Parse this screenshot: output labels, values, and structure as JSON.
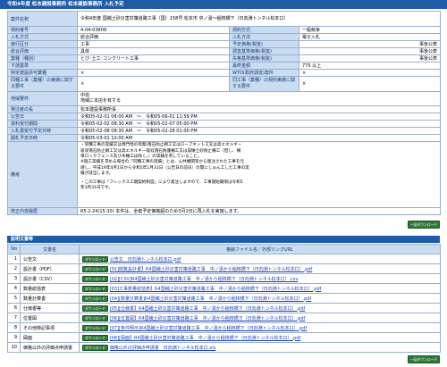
{
  "header": {
    "title": "令和4年度 松本建設事務所 松本建設事務所 入札予定"
  },
  "details": {
    "project_name_label": "案件名称",
    "project_name": "令和4年度 国補土砂災害対策道路工事（国）158号 松本市 中ノ湯～稲核橋下（日向淵トンネル松本口）",
    "contract_no_label": "契約番号",
    "contract_no": "4-04-03809",
    "contract_type_label": "契約方式",
    "contract_type": "一般競争",
    "bid_method_label": "入札方式",
    "bid_method": "総合評価",
    "bid_form_label": "入札方法",
    "bid_form": "電子入札",
    "category_label": "施行区分",
    "category": "工事",
    "price_tier_label": "予定価格(税抜)",
    "price_tier": "事後公表",
    "eval_label": "総合評価",
    "eval": "具体",
    "survey_label": "調査基準価格(税抜)",
    "survey": "事後公表",
    "type_label": "業種（種別）",
    "type": "とび･土工･コンクリート工事",
    "min_label": "失格基準価格(税抜)",
    "min": "事後公表",
    "deadline_label": "下請基準",
    "deadline": "",
    "amount_label": "最終金額",
    "amount": "775 以上",
    "spec_label": "特定建設許可業種",
    "spec": "×",
    "wto_label": "WTO(政府調達)案件",
    "wto": "×",
    "same_label": "同種工事（業種）の実績に関する要件",
    "same": "×",
    "equiv_label": "同工事（業種）の契約実績に関する要件",
    "equiv": "×",
    "region_label": "地域要件",
    "region_1": "中信",
    "region_2": "地域に本店を有する",
    "office_label": "発注者の長",
    "office": "松本建設事務所長",
    "pub_label": "公告日",
    "pub": "令和05-02-01 08:00 AM　～　令和05-06-01 11:59 PM",
    "apply_label": "資料受付期間",
    "apply": "令和05-02-02 08:30 AM　～　令和05-02-07 05:00 PM",
    "bid_label": "入札書受付予定日時",
    "bid": "令和05-02-08 08:30 AM　～　令和05-02-28 01:00 PM",
    "open_label": "開札予定日時",
    "open": "令和05-03-01 10:00 AM",
    "notes_label": "備考",
    "notes_1": "・同種工事の実績又は専門性の有無/落石防止網工又はロープネット工又は高エネルギー",
    "notes_2": "吸収落石防止網工又は高エネルギー吸収落石防護柵工又は崩壊土砂防止柵工（但し、横",
    "notes_3": "単ロックフェンス及び木柵工は除く。）の実績を有していること。",
    "notes_4": "※施工実績を求める場合の「同種工事の実績」とは、公共機関等から発注された工事を元",
    "notes_5": "請し、平成19年4月1日から令和5年1月31日（公告日の前日）の間にしゅん工した工事の実",
    "notes_6": "績が該当します。",
    "notes_7": "・この工事は「フレックス工期契約制度」により発注しますので、工事開始期限は令和5",
    "notes_8": "年3月31日です。",
    "revise_label": "修正内容履歴",
    "revise": "R5.2.24(15:30) 本件は、全者予定価格超のため3月1日に再入札を実施します。"
  },
  "download_all_top": "一括ダウンロード",
  "docs": {
    "title": "拡明文書等",
    "col_no": "No",
    "col_name": "文書名",
    "col_file": "格納ファイル名／外部リンクURL",
    "dl_label": "ダウンロード",
    "rows": [
      {
        "no": "1",
        "name": "公告文",
        "file": "公告文　日向淵トンネル松本口.pdf"
      },
      {
        "no": "2",
        "name": "設計書（PDF）",
        "file": "[01]閲覧設計書】R4国補土砂災害対策道路工事　中ノ湯から稲核橋下（日向淵トンネル松本口）.pdf"
      },
      {
        "no": "3",
        "name": "設計書（CSV）",
        "file": "[02][CSV]R4国補土砂災害対策道路工事　中ノ湯から稲核橋下（日向淵トンネル松本口）.csv"
      },
      {
        "no": "4",
        "name": "数量総括表",
        "file": "[03]工事数量総括表】R4国補土砂災害対策道路工事　中ノ湯から稲核橋下（日向淵トンネル松本口）.pdf"
      },
      {
        "no": "5",
        "name": "数量計算書",
        "file": "[04][数量計算書]R4国補土砂災害対策道路工事　中ノ湯から稲核橋下（日向淵トンネル松本口）.pdf"
      },
      {
        "no": "6",
        "name": "仕様書等",
        "file": "[05][仕様書】R4国補土砂災害対策道路工事　中ノ湯から稲核橋下（日向淵トンネル松本口）.pdf"
      },
      {
        "no": "7",
        "name": "位置図",
        "file": "[06][位置図】R4国補土砂災害対策道路工事　中ノ湯から稲核橋下（日向淵トンネル松本口）.pdf"
      },
      {
        "no": "8",
        "name": "その他特記事項",
        "file": "[07][条件明示]R4国補土砂災害対策道路工事　中ノ湯から稲核橋下（日向淵トンネル松本口）.pdf"
      },
      {
        "no": "9",
        "name": "図面",
        "file": "[08][図面】R4国補土砂災害対策道路工事　中ノ湯から稲核橋下（日向淵トンネル松本口）.pdf"
      },
      {
        "no": "10",
        "name": "価格以外の評価点申請書",
        "file": "価格以外の評価点申請書　日向淵トンネル松本口.xls"
      }
    ]
  },
  "download_all_bottom": "一括ダウンロード"
}
